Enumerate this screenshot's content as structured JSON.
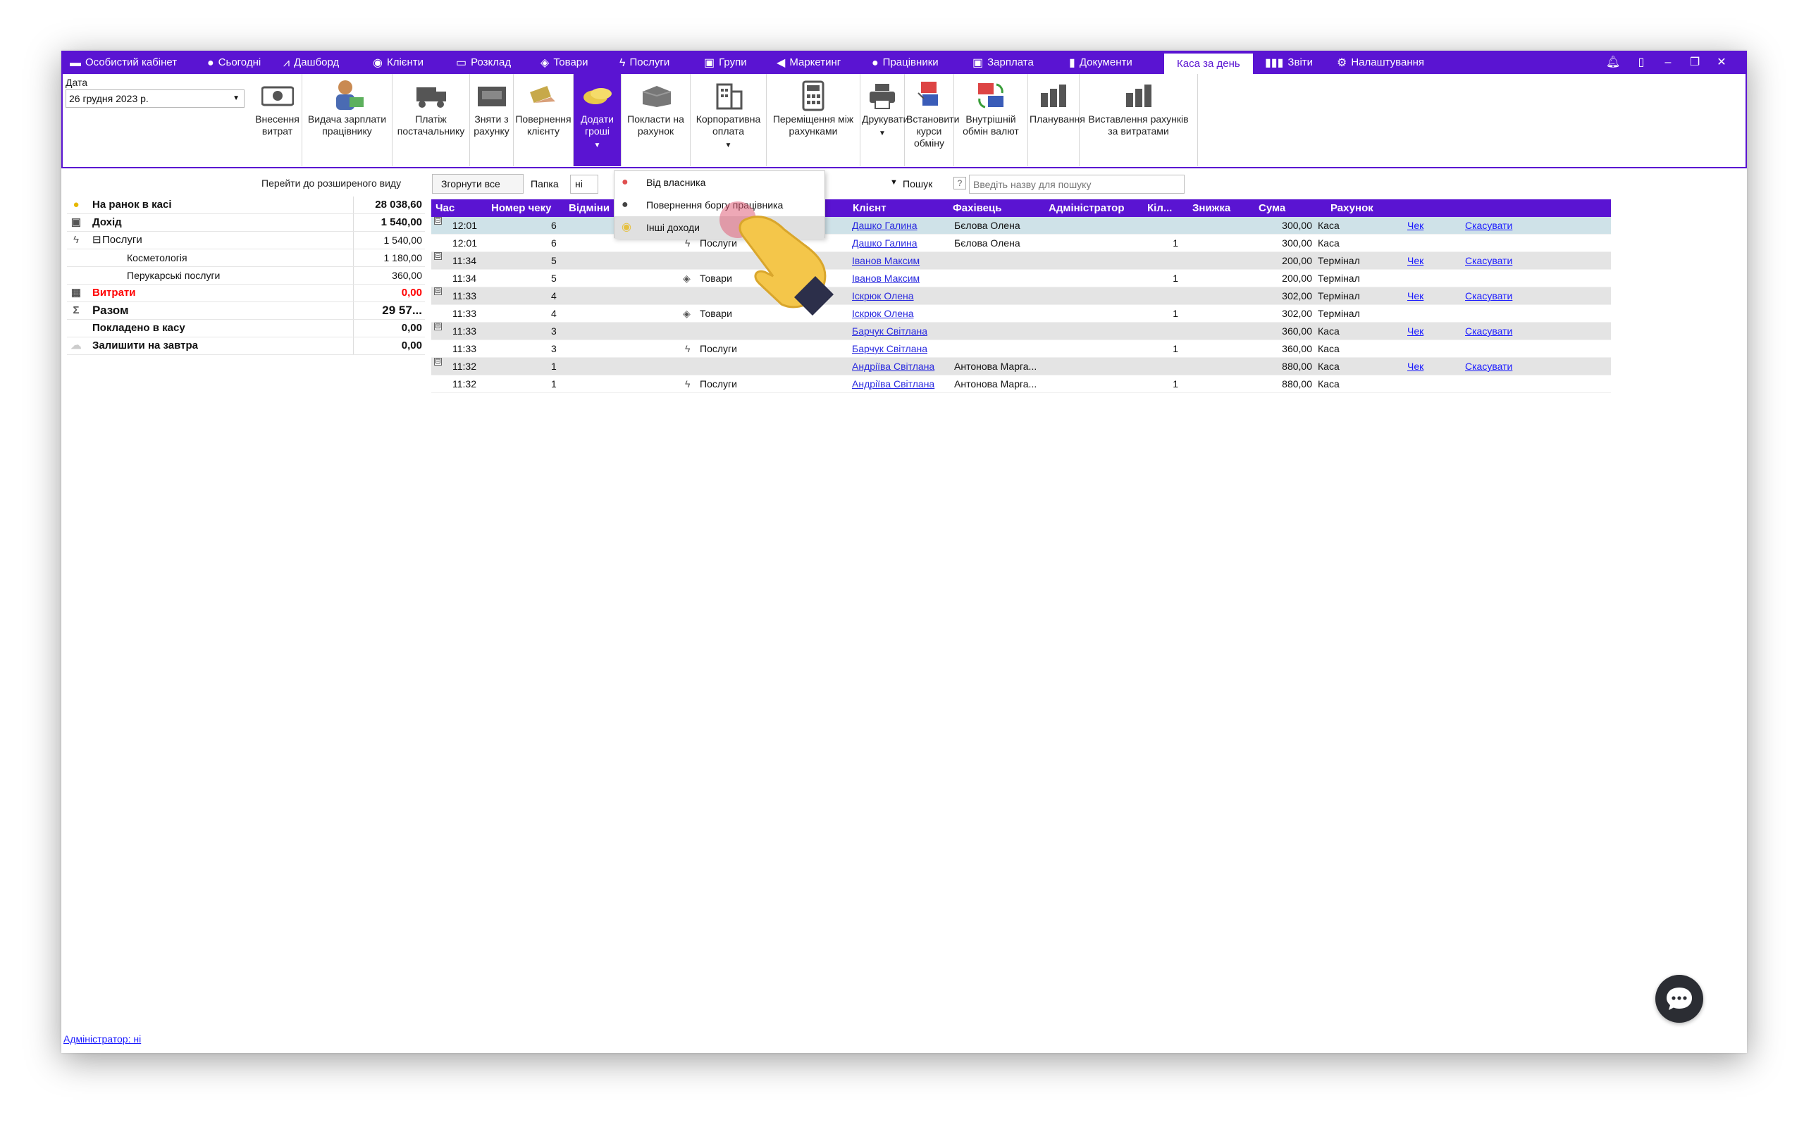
{
  "nav": {
    "items": [
      {
        "label": "Особистий кабінет",
        "icon": "account-icon"
      },
      {
        "label": "Сьогодні",
        "icon": "today-icon"
      },
      {
        "label": "Дашборд",
        "icon": "dashboard-icon"
      },
      {
        "label": "Клієнти",
        "icon": "clients-icon"
      },
      {
        "label": "Розклад",
        "icon": "calendar-icon"
      },
      {
        "label": "Товари",
        "icon": "box-icon"
      },
      {
        "label": "Послуги",
        "icon": "lightning-icon"
      },
      {
        "label": "Групи",
        "icon": "groups-icon"
      },
      {
        "label": "Маркетинг",
        "icon": "megaphone-icon"
      },
      {
        "label": "Працівники",
        "icon": "person-icon"
      },
      {
        "label": "Зарплата",
        "icon": "money-icon"
      },
      {
        "label": "Документи",
        "icon": "document-icon"
      },
      {
        "label": "Каса за день",
        "icon": "",
        "active": true
      },
      {
        "label": "Звіти",
        "icon": "bar-chart-icon"
      },
      {
        "label": "Налаштування",
        "icon": "gear-icon"
      }
    ]
  },
  "date": {
    "label": "Дата",
    "value": "26 грудня  2023 р."
  },
  "ribbon": {
    "buttons": [
      {
        "label": "Внесення\nвитрат",
        "icon": "cash-icon"
      },
      {
        "label": "Видача зарплати\nпрацівнику",
        "icon": "salary-icon"
      },
      {
        "label": "Платіж\nпостачальнику",
        "icon": "truck-icon"
      },
      {
        "label": "Зняти з\nрахунку",
        "icon": "withdraw-icon"
      },
      {
        "label": "Повернення\nклієнту",
        "icon": "refund-icon"
      },
      {
        "label": "Додати\nгроші",
        "icon": "coins-icon",
        "active": true
      },
      {
        "label": "Покласти на\nрахунок",
        "icon": "safe-icon"
      },
      {
        "label": "Корпоративна\nоплата",
        "icon": "building-icon"
      },
      {
        "label": "Переміщення між\nрахунками",
        "icon": "calculator-icon"
      },
      {
        "label": "Друкувати",
        "icon": "printer-icon"
      },
      {
        "label": "Встановити\nкурси обміну",
        "icon": "exchange-rate-icon"
      },
      {
        "label": "Внутрішній\nобмін валют",
        "icon": "currency-exchange-icon"
      },
      {
        "label": "Планування",
        "icon": "planning-chart-icon"
      },
      {
        "label": "Виставлення рахунків\nза витратами",
        "icon": "invoice-chart-icon"
      }
    ]
  },
  "left": {
    "expand_link": "Перейти до розширеного виду",
    "rows": [
      {
        "label": "На ранок в касі",
        "value": "28 038,60",
        "icon": "coin-icon"
      },
      {
        "label": "Дохід",
        "value": "1 540,00",
        "icon": "cash-icon"
      },
      {
        "label": "Послуги",
        "value": "1 540,00",
        "icon": "lightning-icon",
        "expander": "⊟"
      },
      {
        "label": "Косметологія",
        "value": "1 180,00"
      },
      {
        "label": "Перукарські послуги",
        "value": "360,00"
      },
      {
        "label": "Витрати",
        "value": "0,00",
        "icon": "calculator-icon"
      },
      {
        "label": "Разом",
        "value": "29 57...",
        "icon": "sigma-icon"
      },
      {
        "label": "Покладено в касу",
        "value": "0,00"
      },
      {
        "label": "Залишити на завтра",
        "value": "0,00",
        "icon": "cloud-icon"
      }
    ]
  },
  "toolbar": {
    "collapse": "Згорнути все",
    "folder_label": "Папка",
    "folder_value": "ні",
    "search_label": "Пошук",
    "search_help": "?",
    "search_placeholder": "Введіть назву для пошуку"
  },
  "grid": {
    "columns": [
      "Час",
      "Номер чеку",
      "Відміни",
      "Клієнт",
      "Фахівець",
      "Адміністратор",
      "Кіл...",
      "Знижка",
      "Сума",
      "Рахунок"
    ],
    "rows": [
      {
        "kind": "group",
        "expander": "⊟",
        "time": "12:01",
        "check": "6",
        "client": "Дашко Галина",
        "specialist": "Бєлова Олена",
        "admin": "",
        "qty": "",
        "sum": "300,00",
        "account": "Каса",
        "link1": "Чек",
        "link2": "Скасувати",
        "selected": true
      },
      {
        "kind": "item",
        "time": "12:01",
        "check": "6",
        "cat": "Послуги",
        "cat_icon": "lightning-icon",
        "client": "Дашко Галина",
        "specialist": "Бєлова Олена",
        "admin": "",
        "qty": "1",
        "sum": "300,00",
        "account": "Каса"
      },
      {
        "kind": "group",
        "expander": "⊟",
        "time": "11:34",
        "check": "5",
        "client": "Іванов Максим",
        "specialist": "",
        "admin": "",
        "qty": "",
        "sum": "200,00",
        "account": "Термінал",
        "link1": "Чек",
        "link2": "Скасувати"
      },
      {
        "kind": "item",
        "time": "11:34",
        "check": "5",
        "cat": "Товари",
        "cat_icon": "box-icon",
        "client": "Іванов Максим",
        "specialist": "",
        "admin": "",
        "qty": "1",
        "sum": "200,00",
        "account": "Термінал"
      },
      {
        "kind": "group",
        "expander": "⊟",
        "time": "11:33",
        "check": "4",
        "client": "Іскрюк Олена",
        "specialist": "",
        "admin": "",
        "qty": "",
        "sum": "302,00",
        "account": "Термінал",
        "link1": "Чек",
        "link2": "Скасувати"
      },
      {
        "kind": "item",
        "time": "11:33",
        "check": "4",
        "cat": "Товари",
        "cat_icon": "box-icon",
        "client": "Іскрюк Олена",
        "specialist": "",
        "admin": "",
        "qty": "1",
        "sum": "302,00",
        "account": "Термінал"
      },
      {
        "kind": "group",
        "expander": "⊟",
        "time": "11:33",
        "check": "3",
        "client": "Барчук Світлана",
        "specialist": "",
        "admin": "",
        "qty": "",
        "sum": "360,00",
        "account": "Каса",
        "link1": "Чек",
        "link2": "Скасувати"
      },
      {
        "kind": "item",
        "time": "11:33",
        "check": "3",
        "cat": "Послуги",
        "cat_icon": "lightning-icon",
        "client": "Барчук Світлана",
        "specialist": "",
        "admin": "",
        "qty": "1",
        "sum": "360,00",
        "account": "Каса"
      },
      {
        "kind": "group",
        "expander": "⊟",
        "time": "11:32",
        "check": "1",
        "client": "Андріїва Світлана",
        "specialist": "Антонова Марга...",
        "admin": "",
        "qty": "",
        "sum": "880,00",
        "account": "Каса",
        "link1": "Чек",
        "link2": "Скасувати"
      },
      {
        "kind": "item",
        "time": "11:32",
        "check": "1",
        "cat": "Послуги",
        "cat_icon": "lightning-icon",
        "client": "Андріїва Світлана",
        "specialist": "Антонова Марга...",
        "admin": "",
        "qty": "1",
        "sum": "880,00",
        "account": "Каса"
      }
    ]
  },
  "dropdown": {
    "items": [
      {
        "label": "Від власника",
        "icon": "owner-icon"
      },
      {
        "label": "Повернення боргу працівника",
        "icon": "employee-icon"
      },
      {
        "label": "Інші доходи",
        "icon": "coins-icon",
        "hover": true
      }
    ]
  },
  "footer": {
    "admin_link": "Адміністратор: ні"
  },
  "colors": {
    "accent": "#5a14d2",
    "link": "#1a1aff",
    "expense": "#ff0000"
  }
}
